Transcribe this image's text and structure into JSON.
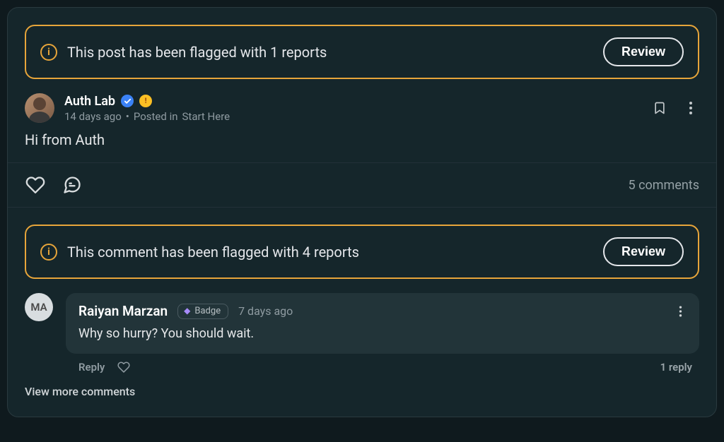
{
  "post": {
    "flag": {
      "text": "This post has been flagged with 1 reports",
      "review_label": "Review"
    },
    "author": "Auth Lab",
    "time": "14 days ago",
    "posted_in_prefix": "Posted in",
    "posted_in": "Start Here",
    "body": "Hi from Auth",
    "comments_count": "5 comments"
  },
  "comment": {
    "flag": {
      "text": "This comment has been flagged with 4 reports",
      "review_label": "Review"
    },
    "avatar_initials": "MA",
    "author": "Raiyan Marzan",
    "badge_label": "Badge",
    "time": "7 days ago",
    "body": "Why so hurry? You should wait.",
    "reply_label": "Reply",
    "reply_count": "1 reply"
  },
  "view_more": "View more comments"
}
